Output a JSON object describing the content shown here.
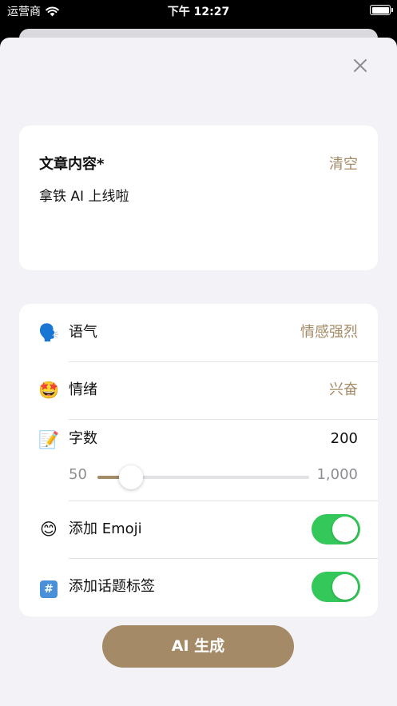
{
  "status_bar": {
    "carrier": "运营商",
    "time": "下午 12:27"
  },
  "article": {
    "title": "文章内容*",
    "clear_label": "清空",
    "content": "拿铁 AI 上线啦"
  },
  "settings": {
    "tone": {
      "emoji": "🗣️",
      "label": "语气",
      "value": "情感强烈"
    },
    "mood": {
      "emoji": "🤩",
      "label": "情绪",
      "value": "兴奋"
    },
    "word_count": {
      "emoji": "📝",
      "label": "字数",
      "value": "200",
      "min_label": "50",
      "max_label": "1,000",
      "level": 0.16
    },
    "add_emoji": {
      "emoji": "😊",
      "label": "添加 Emoji",
      "enabled": true
    },
    "add_hashtags": {
      "emoji": "#️⃣",
      "label": "添加话题标签",
      "enabled": true
    }
  },
  "generate_button": {
    "label": "AI 生成"
  },
  "colors": {
    "accent": "#a48a66",
    "toggle_on": "#34c759",
    "background": "#f2f2f7",
    "card": "#ffffff"
  },
  "icons": [
    "signal-wifi-icon",
    "battery-icon",
    "close-icon"
  ]
}
